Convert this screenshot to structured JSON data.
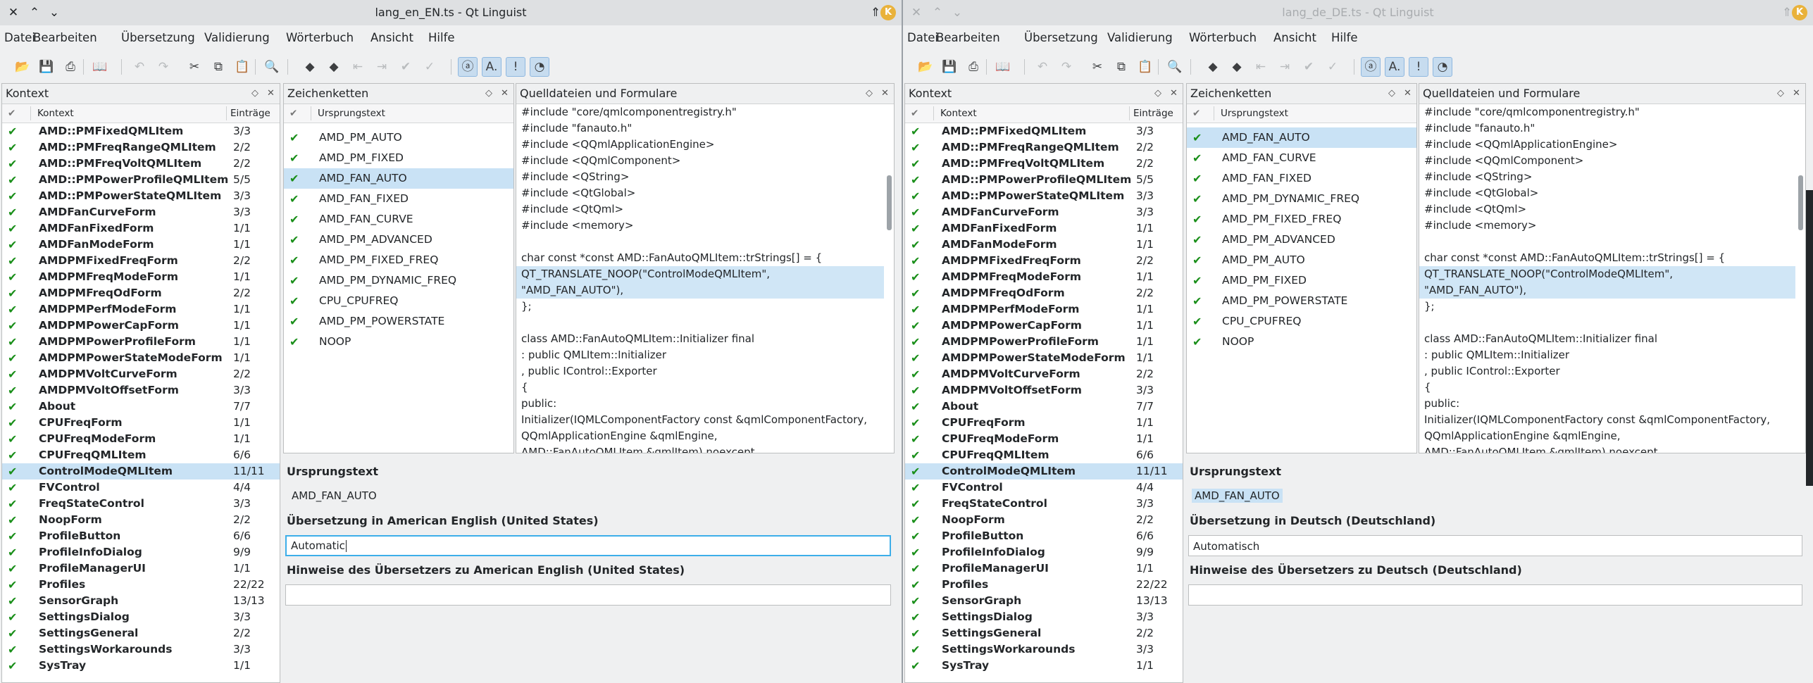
{
  "left": {
    "title": "lang_en_EN.ts - Qt Linguist",
    "menu": [
      "Datei",
      "Bearbeiten",
      "Übersetzung",
      "Validierung",
      "Wörterbuch",
      "Ansicht",
      "Hilfe"
    ],
    "context": {
      "dock_title": "Kontext",
      "col_context": "Kontext",
      "col_count": "Einträge",
      "items": [
        {
          "name": "AMD::PMFixedQMLItem",
          "count": "3/3"
        },
        {
          "name": "AMD::PMFreqRangeQMLItem",
          "count": "2/2"
        },
        {
          "name": "AMD::PMFreqVoltQMLItem",
          "count": "2/2"
        },
        {
          "name": "AMD::PMPowerProfileQMLItem",
          "count": "5/5"
        },
        {
          "name": "AMD::PMPowerStateQMLItem",
          "count": "3/3"
        },
        {
          "name": "AMDFanCurveForm",
          "count": "3/3"
        },
        {
          "name": "AMDFanFixedForm",
          "count": "1/1"
        },
        {
          "name": "AMDFanModeForm",
          "count": "1/1"
        },
        {
          "name": "AMDPMFixedFreqForm",
          "count": "2/2"
        },
        {
          "name": "AMDPMFreqModeForm",
          "count": "1/1"
        },
        {
          "name": "AMDPMFreqOdForm",
          "count": "2/2"
        },
        {
          "name": "AMDPMPerfModeForm",
          "count": "1/1"
        },
        {
          "name": "AMDPMPowerCapForm",
          "count": "1/1"
        },
        {
          "name": "AMDPMPowerProfileForm",
          "count": "1/1"
        },
        {
          "name": "AMDPMPowerStateModeForm",
          "count": "1/1"
        },
        {
          "name": "AMDPMVoltCurveForm",
          "count": "2/2"
        },
        {
          "name": "AMDPMVoltOffsetForm",
          "count": "3/3"
        },
        {
          "name": "About",
          "count": "7/7"
        },
        {
          "name": "CPUFreqForm",
          "count": "1/1"
        },
        {
          "name": "CPUFreqModeForm",
          "count": "1/1"
        },
        {
          "name": "CPUFreqQMLItem",
          "count": "6/6"
        },
        {
          "name": "ControlModeQMLItem",
          "count": "11/11",
          "selected": true
        },
        {
          "name": "FVControl",
          "count": "4/4"
        },
        {
          "name": "FreqStateControl",
          "count": "3/3"
        },
        {
          "name": "NoopForm",
          "count": "2/2"
        },
        {
          "name": "ProfileButton",
          "count": "6/6"
        },
        {
          "name": "ProfileInfoDialog",
          "count": "9/9"
        },
        {
          "name": "ProfileManagerUI",
          "count": "1/1"
        },
        {
          "name": "Profiles",
          "count": "22/22"
        },
        {
          "name": "SensorGraph",
          "count": "13/13"
        },
        {
          "name": "SettingsDialog",
          "count": "3/3"
        },
        {
          "name": "SettingsGeneral",
          "count": "2/2"
        },
        {
          "name": "SettingsWorkarounds",
          "count": "3/3"
        },
        {
          "name": "SysTray",
          "count": "1/1"
        }
      ]
    },
    "strings": {
      "dock_title": "Zeichenketten",
      "col_source": "Ursprungstext",
      "items": [
        {
          "text": "AMD_PM_AUTO"
        },
        {
          "text": "AMD_PM_FIXED"
        },
        {
          "text": "AMD_FAN_AUTO",
          "selected": true
        },
        {
          "text": "AMD_FAN_FIXED"
        },
        {
          "text": "AMD_FAN_CURVE"
        },
        {
          "text": "AMD_PM_ADVANCED"
        },
        {
          "text": "AMD_PM_FIXED_FREQ"
        },
        {
          "text": "AMD_PM_DYNAMIC_FREQ"
        },
        {
          "text": "CPU_CPUFREQ"
        },
        {
          "text": "AMD_PM_POWERSTATE"
        },
        {
          "text": "NOOP"
        }
      ]
    },
    "sources": {
      "dock_title": "Quelldateien und Formulare",
      "lines": [
        {
          "text": "#include \"core/qmlcomponentregistry.h\""
        },
        {
          "text": "#include \"fanauto.h\""
        },
        {
          "text": "#include <QQmlApplicationEngine>"
        },
        {
          "text": "#include <QQmlComponent>"
        },
        {
          "text": "#include <QString>"
        },
        {
          "text": "#include <QtGlobal>"
        },
        {
          "text": "#include <QtQml>"
        },
        {
          "text": "#include <memory>"
        },
        {
          "text": ""
        },
        {
          "text": "char const *const AMD::FanAutoQMLItem::trStrings[] = {"
        },
        {
          "text": "  QT_TRANSLATE_NOOP(\"ControlModeQMLItem\",",
          "hl": true
        },
        {
          "text": "\"AMD_FAN_AUTO\"),",
          "hl": true
        },
        {
          "text": "};"
        },
        {
          "text": ""
        },
        {
          "text": "class AMD::FanAutoQMLItem::Initializer final"
        },
        {
          "text": ": public QMLItem::Initializer"
        },
        {
          "text": ", public IControl::Exporter"
        },
        {
          "text": "{"
        },
        {
          "text": " public:"
        },
        {
          "text": "  Initializer(IQMLComponentFactory const &qmlComponentFactory,"
        },
        {
          "text": "              QQmlApplicationEngine &qmlEngine,"
        },
        {
          "text": "              AMD::FanAutoQMLItem &qmlItem) noexcept"
        }
      ]
    },
    "editor": {
      "source_label": "Ursprungstext",
      "source_value": "AMD_FAN_AUTO",
      "translation_label": "Übersetzung in American English (United States)",
      "translation_value": "Automatic",
      "hints_label": "Hinweise des Übersetzers zu American English (United States)",
      "hints_value": ""
    }
  },
  "right": {
    "title": "lang_de_DE.ts - Qt Linguist",
    "menu": [
      "Datei",
      "Bearbeiten",
      "Übersetzung",
      "Validierung",
      "Wörterbuch",
      "Ansicht",
      "Hilfe"
    ],
    "context": {
      "dock_title": "Kontext",
      "col_context": "Kontext",
      "col_count": "Einträge",
      "items": [
        {
          "name": "AMD::PMFixedQMLItem",
          "count": "3/3"
        },
        {
          "name": "AMD::PMFreqRangeQMLItem",
          "count": "2/2"
        },
        {
          "name": "AMD::PMFreqVoltQMLItem",
          "count": "2/2"
        },
        {
          "name": "AMD::PMPowerProfileQMLItem",
          "count": "5/5"
        },
        {
          "name": "AMD::PMPowerStateQMLItem",
          "count": "3/3"
        },
        {
          "name": "AMDFanCurveForm",
          "count": "3/3"
        },
        {
          "name": "AMDFanFixedForm",
          "count": "1/1"
        },
        {
          "name": "AMDFanModeForm",
          "count": "1/1"
        },
        {
          "name": "AMDPMFixedFreqForm",
          "count": "2/2"
        },
        {
          "name": "AMDPMFreqModeForm",
          "count": "1/1"
        },
        {
          "name": "AMDPMFreqOdForm",
          "count": "2/2"
        },
        {
          "name": "AMDPMPerfModeForm",
          "count": "1/1"
        },
        {
          "name": "AMDPMPowerCapForm",
          "count": "1/1"
        },
        {
          "name": "AMDPMPowerProfileForm",
          "count": "1/1"
        },
        {
          "name": "AMDPMPowerStateModeForm",
          "count": "1/1"
        },
        {
          "name": "AMDPMVoltCurveForm",
          "count": "2/2"
        },
        {
          "name": "AMDPMVoltOffsetForm",
          "count": "3/3"
        },
        {
          "name": "About",
          "count": "7/7"
        },
        {
          "name": "CPUFreqForm",
          "count": "1/1"
        },
        {
          "name": "CPUFreqModeForm",
          "count": "1/1"
        },
        {
          "name": "CPUFreqQMLItem",
          "count": "6/6"
        },
        {
          "name": "ControlModeQMLItem",
          "count": "11/11",
          "selected": true
        },
        {
          "name": "FVControl",
          "count": "4/4"
        },
        {
          "name": "FreqStateControl",
          "count": "3/3"
        },
        {
          "name": "NoopForm",
          "count": "2/2"
        },
        {
          "name": "ProfileButton",
          "count": "6/6"
        },
        {
          "name": "ProfileInfoDialog",
          "count": "9/9"
        },
        {
          "name": "ProfileManagerUI",
          "count": "1/1"
        },
        {
          "name": "Profiles",
          "count": "22/22"
        },
        {
          "name": "SensorGraph",
          "count": "13/13"
        },
        {
          "name": "SettingsDialog",
          "count": "3/3"
        },
        {
          "name": "SettingsGeneral",
          "count": "2/2"
        },
        {
          "name": "SettingsWorkarounds",
          "count": "3/3"
        },
        {
          "name": "SysTray",
          "count": "1/1"
        }
      ]
    },
    "strings": {
      "dock_title": "Zeichenketten",
      "col_source": "Ursprungstext",
      "items": [
        {
          "text": "AMD_FAN_AUTO",
          "selected": true
        },
        {
          "text": "AMD_FAN_CURVE"
        },
        {
          "text": "AMD_FAN_FIXED"
        },
        {
          "text": "AMD_PM_DYNAMIC_FREQ"
        },
        {
          "text": "AMD_PM_FIXED_FREQ"
        },
        {
          "text": "AMD_PM_ADVANCED"
        },
        {
          "text": "AMD_PM_AUTO"
        },
        {
          "text": "AMD_PM_FIXED"
        },
        {
          "text": "AMD_PM_POWERSTATE"
        },
        {
          "text": "CPU_CPUFREQ"
        },
        {
          "text": "NOOP"
        }
      ]
    },
    "sources": {
      "dock_title": "Quelldateien und Formulare",
      "lines": [
        {
          "text": "#include \"core/qmlcomponentregistry.h\""
        },
        {
          "text": "#include \"fanauto.h\""
        },
        {
          "text": "#include <QQmlApplicationEngine>"
        },
        {
          "text": "#include <QQmlComponent>"
        },
        {
          "text": "#include <QString>"
        },
        {
          "text": "#include <QtGlobal>"
        },
        {
          "text": "#include <QtQml>"
        },
        {
          "text": "#include <memory>"
        },
        {
          "text": ""
        },
        {
          "text": "char const *const AMD::FanAutoQMLItem::trStrings[] = {"
        },
        {
          "text": "  QT_TRANSLATE_NOOP(\"ControlModeQMLItem\",",
          "hl": true
        },
        {
          "text": "\"AMD_FAN_AUTO\"),",
          "hl": true
        },
        {
          "text": "};"
        },
        {
          "text": ""
        },
        {
          "text": "class AMD::FanAutoQMLItem::Initializer final"
        },
        {
          "text": ": public QMLItem::Initializer"
        },
        {
          "text": ", public IControl::Exporter"
        },
        {
          "text": "{"
        },
        {
          "text": " public:"
        },
        {
          "text": "  Initializer(IQMLComponentFactory const &qmlComponentFactory,"
        },
        {
          "text": "              QQmlApplicationEngine &qmlEngine,"
        },
        {
          "text": "              AMD::FanAutoQMLItem &qmlItem) noexcept"
        }
      ]
    },
    "editor": {
      "source_label": "Ursprungstext",
      "source_value": "AMD_FAN_AUTO",
      "translation_label": "Übersetzung in Deutsch (Deutschland)",
      "translation_value": "Automatisch",
      "hints_label": "Hinweise des Übersetzers zu Deutsch (Deutschland)",
      "hints_value": ""
    }
  },
  "colors": {
    "selection": "#c9e2f5",
    "check": "#1a8f1a",
    "focus_border": "#3daee9",
    "kde_badge": "#e9b23b"
  },
  "icons": {
    "title_close": "close-icon",
    "title_up": "chevron-up-icon",
    "title_down": "chevron-down-icon",
    "title_keep_above": "keep-above-icon",
    "done_check": "check-icon"
  }
}
